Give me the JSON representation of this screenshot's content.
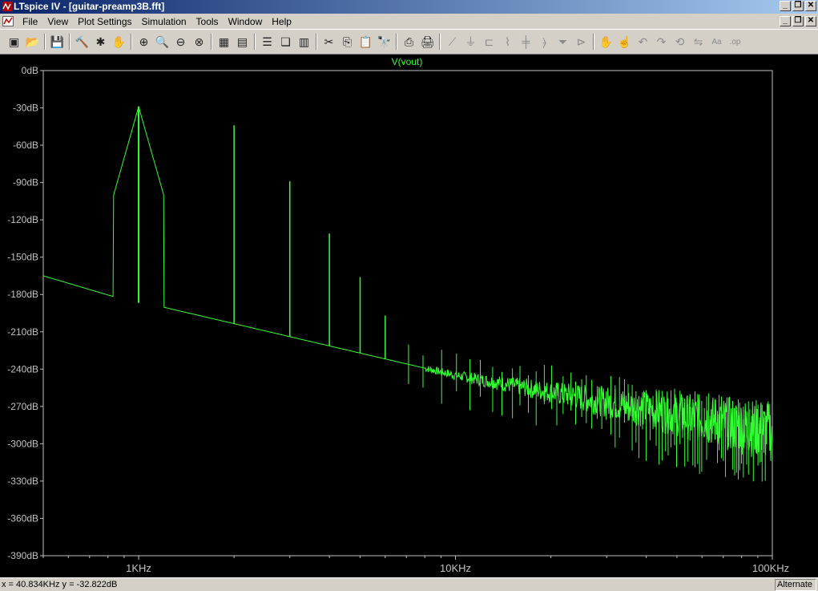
{
  "window": {
    "title": "LTspice IV - [guitar-preamp3B.fft]",
    "controls": [
      "_",
      "❐",
      "✕"
    ]
  },
  "menubar": {
    "items": [
      "File",
      "View",
      "Plot Settings",
      "Simulation",
      "Tools",
      "Window",
      "Help"
    ]
  },
  "toolbar": {
    "icons": [
      {
        "name": "new-schematic-icon",
        "glyph": "▣"
      },
      {
        "name": "open-icon",
        "glyph": "📂"
      },
      {
        "name": "save-icon",
        "glyph": "💾"
      },
      {
        "name": "control-panel-icon",
        "glyph": "🔨"
      },
      {
        "name": "run-icon",
        "glyph": "✱"
      },
      {
        "name": "pan-icon",
        "glyph": "✋"
      },
      {
        "name": "zoom-in-icon",
        "glyph": "⊕"
      },
      {
        "name": "zoom-area-icon",
        "glyph": "🔍"
      },
      {
        "name": "zoom-out-icon",
        "glyph": "⊖"
      },
      {
        "name": "zoom-fit-icon",
        "glyph": "⊗"
      },
      {
        "name": "autorange-icon",
        "glyph": "▦"
      },
      {
        "name": "pick-visible-traces-icon",
        "glyph": "▤"
      },
      {
        "name": "tile-horizontal-icon",
        "glyph": "☰"
      },
      {
        "name": "cascade-icon",
        "glyph": "❏"
      },
      {
        "name": "tile-vertical-icon",
        "glyph": "▥"
      },
      {
        "name": "cut-icon",
        "glyph": "✂"
      },
      {
        "name": "copy-icon",
        "glyph": "⎘"
      },
      {
        "name": "paste-icon",
        "glyph": "📋"
      },
      {
        "name": "find-icon",
        "glyph": "🔭"
      },
      {
        "name": "print-preview-icon",
        "glyph": "⎙"
      },
      {
        "name": "print-icon",
        "glyph": "🖨"
      },
      {
        "name": "wire-icon",
        "glyph": "⟋"
      },
      {
        "name": "ground-icon",
        "glyph": "⏚"
      },
      {
        "name": "label-net-icon",
        "glyph": "⊏"
      },
      {
        "name": "resistor-icon",
        "glyph": "⌇"
      },
      {
        "name": "capacitor-icon",
        "glyph": "╪"
      },
      {
        "name": "inductor-icon",
        "glyph": "⦒"
      },
      {
        "name": "diode-icon",
        "glyph": "⏷"
      },
      {
        "name": "component-icon",
        "glyph": "⊳"
      },
      {
        "name": "move-icon",
        "glyph": "✋"
      },
      {
        "name": "drag-icon",
        "glyph": "☝"
      },
      {
        "name": "undo-icon",
        "glyph": "↶"
      },
      {
        "name": "redo-icon",
        "glyph": "↷"
      },
      {
        "name": "rotate-icon",
        "glyph": "⟲"
      },
      {
        "name": "mirror-icon",
        "glyph": "⇋"
      },
      {
        "name": "text-icon",
        "glyph": "Aa"
      },
      {
        "name": "spice-directive-icon",
        "glyph": ".op"
      }
    ]
  },
  "plot": {
    "trace_label": "V(vout)",
    "trace_color": "#33ff33",
    "axis_color": "#c0c0c0",
    "grid": false,
    "chart_data": {
      "type": "line",
      "title": "V(vout)",
      "xscale": "log",
      "xlim_hz": [
        500,
        100000
      ],
      "ylim_db": [
        -390,
        0
      ],
      "xticks": [
        "1KHz",
        "10KHz",
        "100KHz"
      ],
      "yticks": [
        "0dB",
        "-30dB",
        "-60dB",
        "-90dB",
        "-120dB",
        "-150dB",
        "-180dB",
        "-210dB",
        "-240dB",
        "-270dB",
        "-300dB",
        "-330dB",
        "-360dB",
        "-390dB"
      ],
      "series": [
        {
          "name": "V(vout)",
          "noise_floor_db": [
            [
              500,
              -165
            ],
            [
              950,
              -186
            ],
            [
              1100,
              -188
            ],
            [
              10000,
              -245
            ],
            [
              100000,
              -290
            ]
          ],
          "peaks": [
            {
              "freq_hz": 1000,
              "db": -29
            },
            {
              "freq_hz": 2000,
              "db": -44
            },
            {
              "freq_hz": 3000,
              "db": -89
            },
            {
              "freq_hz": 4000,
              "db": -131
            },
            {
              "freq_hz": 5000,
              "db": -166
            },
            {
              "freq_hz": 6000,
              "db": -197
            }
          ]
        }
      ]
    }
  },
  "status": {
    "cursor": "x = 40.834KHz    y = -32.822dB",
    "mode": "Alternate"
  }
}
